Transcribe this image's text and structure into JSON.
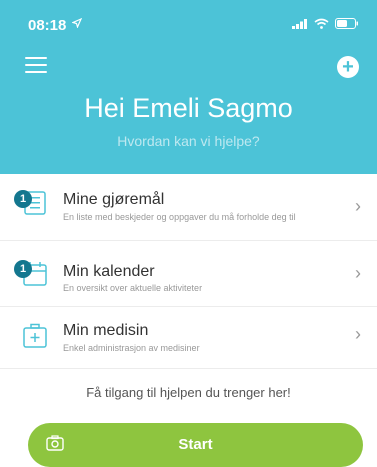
{
  "status": {
    "time": "08:18"
  },
  "header": {
    "greeting": "Hei Emeli Sagmo",
    "subtitle": "Hvordan kan vi hjelpe?"
  },
  "items": [
    {
      "title": "Mine gjøremål",
      "desc": "En liste med beskjeder og oppgaver du må forholde deg til",
      "badge": "1"
    },
    {
      "title": "Min kalender",
      "desc": "En oversikt over aktuelle aktiviteter",
      "badge": "1"
    },
    {
      "title": "Min medisin",
      "desc": "Enkel administrasjon av medisiner"
    }
  ],
  "footer": {
    "access_text": "Få tilgang til hjelpen du trenger her!",
    "start_label": "Start"
  },
  "colors": {
    "header_bg": "#4cc3d7",
    "accent": "#8ec53f",
    "badge": "#14778f"
  }
}
